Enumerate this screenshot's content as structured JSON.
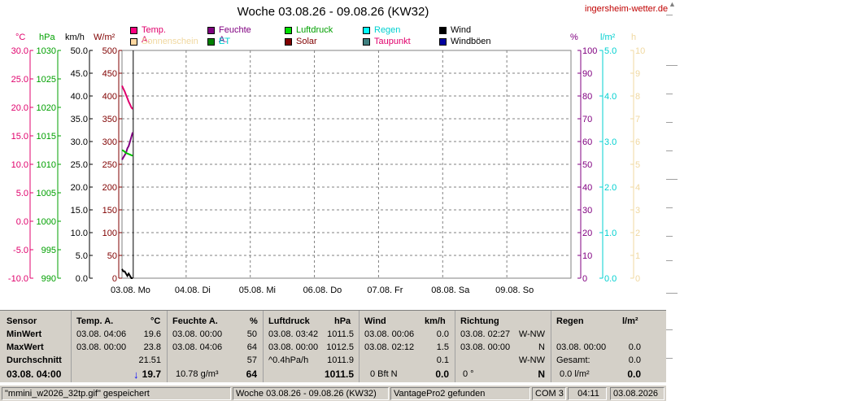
{
  "title": "Woche 03.08.26 - 09.08.26 (KW32)",
  "site": "ingersheim-wetter.de",
  "axis_units": {
    "temp": "°C",
    "hpa": "hPa",
    "kmh": "km/h",
    "wm2": "W/m²",
    "pct": "%",
    "lm2": "l/m²",
    "h": "h"
  },
  "colors": {
    "temp": "#e0006c",
    "hpa": "#00a000",
    "kmh": "#000000",
    "wm2": "#800000",
    "pct": "#800080",
    "lm2": "#00d0d0",
    "h": "#f0d8a0",
    "grid": "#808080"
  },
  "legend": [
    {
      "label": "Temp. A.",
      "color": "#ff0080"
    },
    {
      "label": "Feuchte A.",
      "color": "#800080"
    },
    {
      "label": "Luftdruck",
      "color": "#00e000"
    },
    {
      "label": "Regen",
      "color": "#00ffff"
    },
    {
      "label": "Wind",
      "color": "#000000"
    },
    {
      "label": "Sonnenschein",
      "color": "#ffd8a0"
    },
    {
      "label": "ET",
      "color": "#008000"
    },
    {
      "label": "Solar",
      "color": "#800000"
    },
    {
      "label": "Taupunkt",
      "color": "#408080"
    },
    {
      "label": "Windböen",
      "color": "#0000a0"
    }
  ],
  "legend_text_colors": [
    "#e0006c",
    "#800080",
    "#00a000",
    "#00d0d0",
    "#000000",
    "#f0d8a0",
    "#00d0d0",
    "#800000",
    "#e0006c",
    "#000000"
  ],
  "chart_data": {
    "type": "line",
    "title": "Woche 03.08.26 - 09.08.26 (KW32)",
    "x_categories": [
      "03.08.  Mo",
      "04.08.  Di",
      "05.08.  Mi",
      "06.08.  Do",
      "07.08.  Fr",
      "08.08.  Sa",
      "09.08.  So"
    ],
    "axes": {
      "temp": {
        "unit": "°C",
        "range": [
          -10,
          30
        ],
        "ticks": [
          "30.0",
          "25.0",
          "20.0",
          "15.0",
          "10.0",
          "5.0",
          "0.0",
          "-5.0",
          "-10.0"
        ]
      },
      "hpa": {
        "unit": "hPa",
        "range": [
          990,
          1030
        ],
        "ticks": [
          "1030",
          "1025",
          "1020",
          "1015",
          "1010",
          "1005",
          "1000",
          "995",
          "990"
        ]
      },
      "kmh": {
        "unit": "km/h",
        "range": [
          0,
          50
        ],
        "ticks": [
          "50.0",
          "45.0",
          "40.0",
          "35.0",
          "30.0",
          "25.0",
          "20.0",
          "15.0",
          "10.0",
          "5.0",
          "0.0"
        ]
      },
      "wm2": {
        "unit": "W/m²",
        "range": [
          0,
          500
        ],
        "ticks": [
          "500",
          "450",
          "400",
          "350",
          "300",
          "250",
          "200",
          "150",
          "100",
          "50",
          "0"
        ]
      },
      "pct": {
        "unit": "%",
        "range": [
          0,
          100
        ],
        "ticks": [
          "100",
          "90",
          "80",
          "70",
          "60",
          "50",
          "40",
          "30",
          "20",
          "10",
          "0"
        ]
      },
      "lm2": {
        "unit": "l/m²",
        "range": [
          0,
          5
        ],
        "ticks": [
          "5.0",
          "4.0",
          "3.0",
          "2.0",
          "1.0",
          "0.0"
        ]
      },
      "h": {
        "unit": "h",
        "range": [
          0,
          10
        ],
        "ticks": [
          "10",
          "9",
          "8",
          "7",
          "6",
          "5",
          "4",
          "3",
          "2",
          "1",
          "0"
        ]
      }
    },
    "series": [
      {
        "name": "Temp. A.",
        "axis": "temp",
        "color": "#e0006c",
        "hours": [
          0,
          0.5,
          1,
          1.5,
          2,
          2.5,
          3,
          3.5,
          4
        ],
        "values": [
          23.8,
          23.3,
          22.8,
          22.2,
          21.6,
          21.0,
          20.5,
          20.0,
          19.7
        ]
      },
      {
        "name": "Feuchte A.",
        "axis": "pct",
        "color": "#800080",
        "hours": [
          0,
          0.5,
          1,
          1.5,
          2,
          2.5,
          3,
          3.5,
          4
        ],
        "values": [
          52,
          53,
          54,
          55,
          57,
          58,
          60,
          62,
          64
        ]
      },
      {
        "name": "Luftdruck",
        "axis": "hpa",
        "color": "#00c000",
        "hours": [
          0,
          0.5,
          1,
          1.5,
          2,
          2.5,
          3,
          3.5,
          4
        ],
        "values": [
          1012.5,
          1012.4,
          1012.2,
          1012.0,
          1011.9,
          1011.8,
          1011.7,
          1011.6,
          1011.5
        ]
      },
      {
        "name": "Windböen",
        "axis": "kmh",
        "color": "#000000",
        "hours": [
          0,
          0.5,
          1,
          1.5,
          2,
          2.5,
          3,
          3.5,
          4
        ],
        "values": [
          2.0,
          1.5,
          1.5,
          1.0,
          0.5,
          1.0,
          0.5,
          0.0,
          0.0
        ]
      }
    ],
    "grid": true
  },
  "table": {
    "columns": [
      {
        "title": "Sensor",
        "unit": ""
      },
      {
        "title": "Temp. A.",
        "unit": "°C"
      },
      {
        "title": "Feuchte A.",
        "unit": "%"
      },
      {
        "title": "Luftdruck",
        "unit": "hPa"
      },
      {
        "title": "Wind",
        "unit": "km/h"
      },
      {
        "title": "Richtung",
        "unit": ""
      },
      {
        "title": "Regen",
        "unit": "l/m²"
      }
    ],
    "rows": [
      {
        "label": "MinWert",
        "temp": [
          "03.08.  04:06",
          "19.6"
        ],
        "hum": [
          "03.08.  00:00",
          "50"
        ],
        "press": [
          "03.08.  03:42",
          "1011.5"
        ],
        "wind": [
          "03.08.  00:06",
          "0.0"
        ],
        "dir": [
          "03.08.  02:27",
          "W-NW"
        ],
        "rain": [
          "",
          ""
        ]
      },
      {
        "label": "MaxWert",
        "temp": [
          "03.08.  00:00",
          "23.8"
        ],
        "hum": [
          "03.08.  04:06",
          "64"
        ],
        "press": [
          "03.08.  00:00",
          "1012.5"
        ],
        "wind": [
          "03.08.  02:12",
          "1.5"
        ],
        "dir": [
          "03.08.  00:00",
          "N"
        ],
        "rain": [
          "03.08.  00:00",
          "0.0"
        ]
      },
      {
        "label": "Durchschnitt",
        "temp": [
          "",
          "21.51"
        ],
        "hum": [
          "",
          "57"
        ],
        "press": [
          "^0.4hPa/h",
          "1011.9"
        ],
        "wind": [
          "",
          "0.1"
        ],
        "dir": [
          "",
          "W-NW"
        ],
        "rain": [
          "Gesamt:",
          "0.0"
        ]
      }
    ],
    "current": {
      "label": "03.08. 04:00",
      "temp_arrow": "↓",
      "temp": "19.7",
      "hum_extra": "10.78 g/m³",
      "hum": "64",
      "press": "1011.5",
      "wind_extra": "0 Bft N",
      "wind": "0.0",
      "dir_extra": "0 °",
      "dir": "N",
      "rain_extra": "0.0 l/m²",
      "rain": "0.0"
    }
  },
  "statusbar": [
    "\"mmini_w2026_32tp.gif\"  gespeichert",
    "Woche 03.08.26 - 09.08.26 (KW32)",
    "VantagePro2 gefunden",
    "COM 3",
    "04:11",
    "03.08.2026"
  ]
}
